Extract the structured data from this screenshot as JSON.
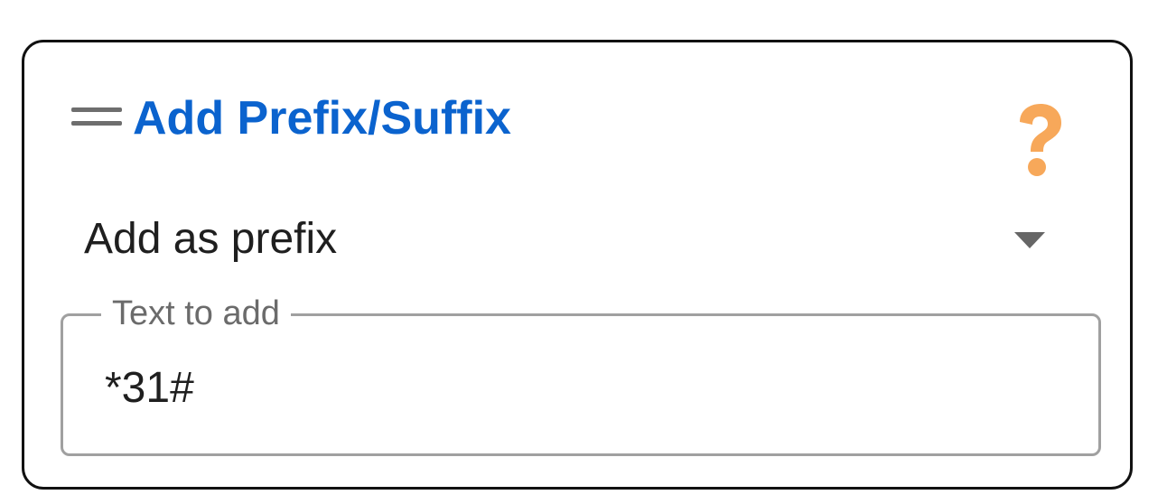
{
  "panel": {
    "title": "Add Prefix/Suffix",
    "drag_handle_icon": "drag-handle-icon",
    "help_icon": "question-mark-icon",
    "title_color": "#0b63ce",
    "help_color": "#f7a85a"
  },
  "mode_select": {
    "selected": "Add as prefix",
    "caret_icon": "caret-down-icon"
  },
  "text_field": {
    "label": "Text to add",
    "value": "*31#"
  }
}
